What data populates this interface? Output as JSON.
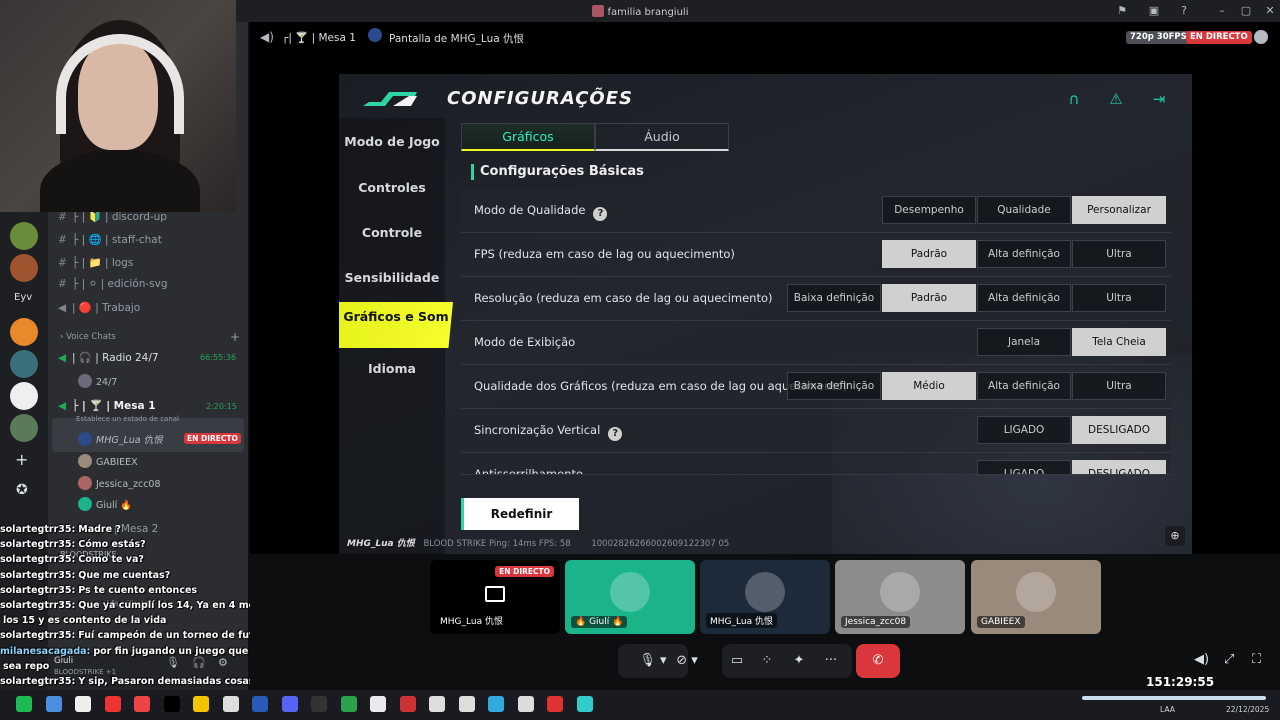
{
  "window": {
    "title": "familia brangiuli"
  },
  "sidebar": {
    "channels": [
      {
        "label": "├ | 🔰 | discord-up"
      },
      {
        "label": "├ | 🌐 | staff-chat"
      },
      {
        "label": "├ | 📁 | logs"
      },
      {
        "label": "├ | ⚪ | edición-svg"
      },
      {
        "label": "| 🔴 | Trabajo"
      }
    ],
    "rail_label": "Eyv",
    "voice_header": "Voice Chats",
    "radio": {
      "label": "| 🎧 | Radio 24/7",
      "time": "66:55:36",
      "user": "24/7"
    },
    "mesa1": {
      "label": "├ | 🍸 | Mesa 1",
      "time": "2:20:15",
      "status": "Establece un estado de canal"
    },
    "users": [
      {
        "name": "MHG_Lua 仇恨",
        "badge": "EN DIRECTO"
      },
      {
        "name": "GABIEEX"
      },
      {
        "name": "Jessica_zcc08"
      },
      {
        "name": "Giulí 🔥"
      }
    ],
    "mesa2": "| Mesa 2",
    "bloodstrike": "BLOODSTRIKE",
    "familia": "| familia bra",
    "me": {
      "name": "Giuli",
      "sub": "BLOODSTRIKE +1"
    }
  },
  "chat": [
    {
      "user": "solartegtrr35:",
      "text": "Madre ?"
    },
    {
      "user": "solartegtrr35:",
      "text": "Cómo estás?"
    },
    {
      "user": "solartegtrr35:",
      "text": "Como te va?"
    },
    {
      "user": "solartegtrr35:",
      "text": "Que me cuentas?"
    },
    {
      "user": "solartegtrr35:",
      "text": "Ps te cuento entonces"
    },
    {
      "user": "solartegtrr35:",
      "text": "Que ya cumplí los 14, Ya en 4 meses"
    },
    {
      "user": "",
      "text": "los 15 y es contento de la vida"
    },
    {
      "user": "solartegtrr35:",
      "text": "Fuí campeón de un torneo de futbol"
    },
    {
      "user": "milanesacagada:",
      "text": "por fin jugando un juego que no"
    },
    {
      "user": "",
      "text": "sea repo"
    },
    {
      "user": "solartegtrr35:",
      "text": "Y sip, Pasaron demasiadas cosas"
    },
    {
      "user": "solartegtrr35:",
      "text": ":)"
    },
    {
      "user": "milanesacagada:",
      "text": ""
    }
  ],
  "stream_header": {
    "channel": "┌| 🍸 | Mesa 1",
    "screen": "Pantalla de MHG_Lua 仇恨",
    "quality": "720p 30FPS",
    "live": "EN DIRECTO"
  },
  "game": {
    "title": "CONFIGURAÇÕES",
    "menu": [
      "Modo de Jogo",
      "Controles",
      "Controle",
      "Sensibilidade",
      "Gráficos e Som",
      "Idioma"
    ],
    "active_menu": "Gráficos e Som",
    "tabs": [
      "Gráficos",
      "Áudio"
    ],
    "section": "Configurações Básicas",
    "rows": [
      {
        "label": "Modo de Qualidade",
        "help": "?",
        "options": [
          "Desempenho",
          "Qualidade",
          "Personalizar"
        ],
        "selected": "Personalizar"
      },
      {
        "label": "FPS (reduza em caso de lag ou aquecimento)",
        "options": [
          "Padrão",
          "Alta definição",
          "Ultra"
        ],
        "selected": "Padrão"
      },
      {
        "label": "Resolução (reduza em caso de lag ou aquecimento)",
        "options": [
          "Baixa definição",
          "Padrão",
          "Alta definição",
          "Ultra"
        ],
        "selected": "Padrão"
      },
      {
        "label": "Modo de Exibição",
        "options": [
          "Janela",
          "Tela Cheia"
        ],
        "selected": "Tela Cheia"
      },
      {
        "label": "Qualidade dos Gráficos (reduza em caso de lag ou aquecimento)",
        "options": [
          "Baixa definição",
          "Médio",
          "Alta definição",
          "Ultra"
        ],
        "selected": "Médio"
      },
      {
        "label": "Sincronização Vertical",
        "help": "?",
        "options": [
          "LIGADO",
          "DESLIGADO"
        ],
        "selected": "DESLIGADO"
      },
      {
        "label": "Antisserrilhamento",
        "options": [
          "LIGADO",
          "DESLIGADO"
        ],
        "selected": "DESLIGADO"
      }
    ],
    "reset": "Redefinir",
    "footer_name": "MHG_Lua 仇恨",
    "footer_stats": "BLOOD STRIKE  Ping: 14ms FPS: 58",
    "footer_id": "10002826266002609122307 05"
  },
  "tiles": [
    {
      "name": "MHG_Lua 仇恨",
      "badge": "EN DIRECTO",
      "color": "#000000"
    },
    {
      "name": "🔥 Giulí 🔥",
      "color": "#1bb38a"
    },
    {
      "name": "MHG_Lua 仇恨",
      "color": "#1c2a3a"
    },
    {
      "name": "Jessica_zcc08",
      "color": "#8c8c8c"
    },
    {
      "name": "GABIEEX",
      "color": "#9a8a7c"
    }
  ],
  "timer": "151:29:55",
  "taskbar": {
    "lang": "LAA",
    "date": "22/12/2025"
  },
  "colors": {
    "accent_green": "#23c9a4",
    "yellow": "#f2f52a",
    "live_red": "#da373c",
    "leave_red": "#da373c"
  }
}
